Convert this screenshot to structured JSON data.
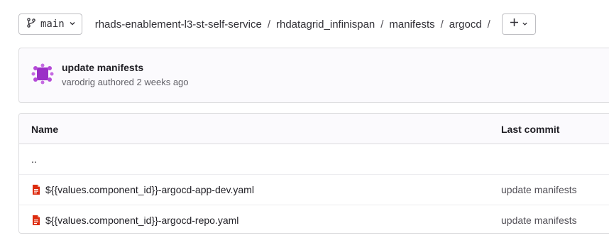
{
  "branch": {
    "label": "main"
  },
  "breadcrumb": [
    "rhads-enablement-l3-st-self-service",
    "rhdatagrid_infinispan",
    "manifests",
    "argocd"
  ],
  "breadcrumb_sep": "/",
  "commit": {
    "title": "update manifests",
    "meta": "varodrig authored 2 weeks ago"
  },
  "table": {
    "headers": {
      "name": "Name",
      "last_commit": "Last commit"
    },
    "parent": "..",
    "rows": [
      {
        "name": "${{values.component_id}}-argocd-app-dev.yaml",
        "commit": "update manifests"
      },
      {
        "name": "${{values.component_id}}-argocd-repo.yaml",
        "commit": "update manifests"
      }
    ]
  },
  "colors": {
    "file_icon": "#dd2b0e",
    "avatar": "#9b2fc7"
  }
}
